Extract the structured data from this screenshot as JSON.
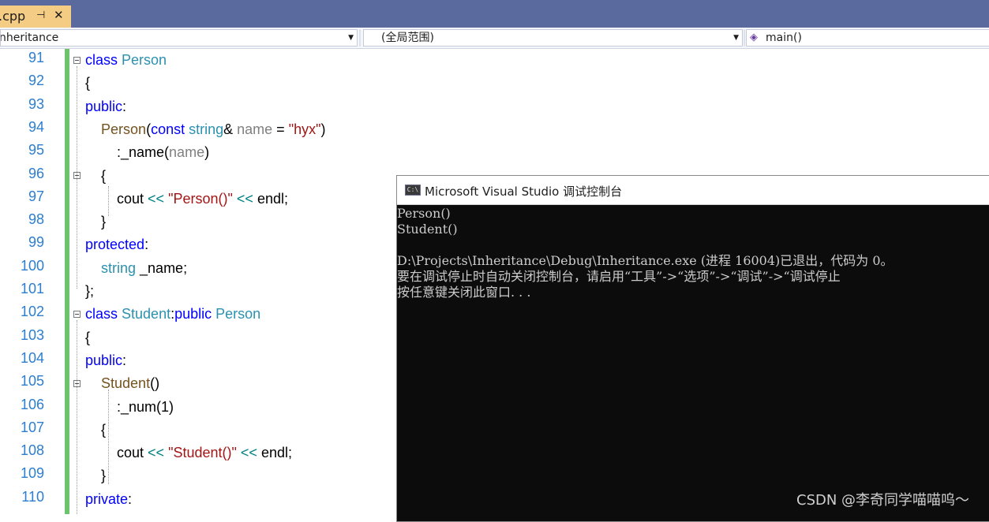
{
  "tab": {
    "title": ".cpp",
    "pin_glyph": "⊣",
    "close_glyph": "✕"
  },
  "nav": {
    "project": "nheritance",
    "scope": "(全局范围)",
    "member": "main()"
  },
  "editor": {
    "line_numbers": [
      "91",
      "92",
      "93",
      "94",
      "95",
      "96",
      "97",
      "98",
      "99",
      "100",
      "101",
      "102",
      "103",
      "104",
      "105",
      "106",
      "107",
      "108",
      "109",
      "110"
    ]
  },
  "code": [
    [
      {
        "t": "class",
        "c": "kw"
      },
      {
        "t": " "
      },
      {
        "t": "Person",
        "c": "ty"
      }
    ],
    [
      {
        "t": "{"
      }
    ],
    [
      {
        "t": "public",
        "c": "kw"
      },
      {
        "t": ":"
      }
    ],
    [
      {
        "t": "    "
      },
      {
        "t": "Person",
        "c": "fn"
      },
      {
        "t": "("
      },
      {
        "t": "const",
        "c": "kw"
      },
      {
        "t": " "
      },
      {
        "t": "string",
        "c": "ty"
      },
      {
        "t": "& "
      },
      {
        "t": "name",
        "c": "pa"
      },
      {
        "t": " = "
      },
      {
        "t": "\"hyx\"",
        "c": "st"
      },
      {
        "t": ")"
      }
    ],
    [
      {
        "t": "        :_name("
      },
      {
        "t": "name",
        "c": "pa"
      },
      {
        "t": ")"
      }
    ],
    [
      {
        "t": "    {"
      }
    ],
    [
      {
        "t": "        cout "
      },
      {
        "t": "<<",
        "c": "op"
      },
      {
        "t": " "
      },
      {
        "t": "\"Person()\"",
        "c": "st"
      },
      {
        "t": " "
      },
      {
        "t": "<<",
        "c": "op"
      },
      {
        "t": " endl;"
      }
    ],
    [
      {
        "t": "    }"
      }
    ],
    [
      {
        "t": "protected",
        "c": "kw"
      },
      {
        "t": ":"
      }
    ],
    [
      {
        "t": "    "
      },
      {
        "t": "string",
        "c": "ty"
      },
      {
        "t": " _name;"
      }
    ],
    [
      {
        "t": "};"
      }
    ],
    [
      {
        "t": "class",
        "c": "kw"
      },
      {
        "t": " "
      },
      {
        "t": "Student",
        "c": "ty"
      },
      {
        "t": ":"
      },
      {
        "t": "public",
        "c": "kw"
      },
      {
        "t": " "
      },
      {
        "t": "Person",
        "c": "ty"
      }
    ],
    [
      {
        "t": "{"
      }
    ],
    [
      {
        "t": "public",
        "c": "kw"
      },
      {
        "t": ":"
      }
    ],
    [
      {
        "t": "    "
      },
      {
        "t": "Student",
        "c": "fn"
      },
      {
        "t": "()"
      }
    ],
    [
      {
        "t": "        :_num(1)"
      }
    ],
    [
      {
        "t": "    {"
      }
    ],
    [
      {
        "t": "        cout "
      },
      {
        "t": "<<",
        "c": "op"
      },
      {
        "t": " "
      },
      {
        "t": "\"Student()\"",
        "c": "st"
      },
      {
        "t": " "
      },
      {
        "t": "<<",
        "c": "op"
      },
      {
        "t": " endl;"
      }
    ],
    [
      {
        "t": "    }"
      }
    ],
    [
      {
        "t": "private",
        "c": "kw"
      },
      {
        "t": ":"
      }
    ]
  ],
  "console": {
    "title": "Microsoft Visual Studio 调试控制台",
    "icon_text": "C:\\",
    "lines": [
      "Person()",
      "Student()",
      "",
      "D:\\Projects\\Inheritance\\Debug\\Inheritance.exe (进程 16004)已退出，代码为 0。",
      "要在调试停止时自动关闭控制台，请启用“工具”->“选项”->“调试”->“调试停止",
      "按任意键关闭此窗口. . ."
    ]
  },
  "watermark": "CSDN @李奇同学喵喵呜～"
}
